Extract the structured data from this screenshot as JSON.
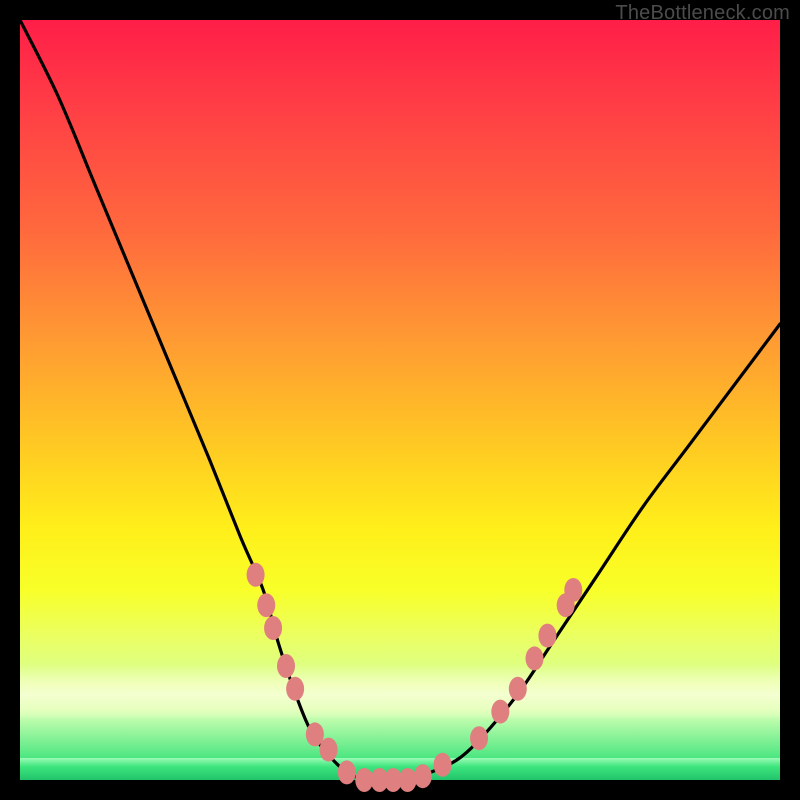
{
  "watermark": {
    "text": "TheBottleneck.com"
  },
  "colors": {
    "curve_stroke": "#000000",
    "marker_fill": "#e07f7f",
    "marker_stroke": "#e07f7f"
  },
  "chart_data": {
    "type": "line",
    "title": "",
    "xlabel": "",
    "ylabel": "",
    "xlim": [
      0,
      100
    ],
    "ylim": [
      0,
      100
    ],
    "grid": false,
    "series": [
      {
        "name": "bottleneck-curve",
        "x": [
          0,
          5,
          10,
          15,
          20,
          25,
          29,
          32,
          34,
          36,
          38,
          40,
          43,
          46,
          50,
          54,
          58,
          62,
          66,
          70,
          76,
          82,
          88,
          94,
          100
        ],
        "y": [
          100,
          90,
          78,
          66,
          54,
          42,
          32,
          25,
          18,
          12,
          7,
          4,
          1,
          0,
          0,
          1,
          3,
          7,
          12,
          18,
          27,
          36,
          44,
          52,
          60
        ]
      }
    ],
    "markers": [
      {
        "x": 31.0,
        "y": 27
      },
      {
        "x": 32.4,
        "y": 23
      },
      {
        "x": 33.3,
        "y": 20
      },
      {
        "x": 35.0,
        "y": 15
      },
      {
        "x": 36.2,
        "y": 12
      },
      {
        "x": 38.8,
        "y": 6
      },
      {
        "x": 40.6,
        "y": 4
      },
      {
        "x": 43.0,
        "y": 1
      },
      {
        "x": 45.3,
        "y": 0
      },
      {
        "x": 47.3,
        "y": 0
      },
      {
        "x": 49.1,
        "y": 0
      },
      {
        "x": 51.0,
        "y": 0
      },
      {
        "x": 53.0,
        "y": 0.5
      },
      {
        "x": 55.6,
        "y": 2
      },
      {
        "x": 60.4,
        "y": 5.5
      },
      {
        "x": 63.2,
        "y": 9
      },
      {
        "x": 65.5,
        "y": 12
      },
      {
        "x": 67.7,
        "y": 16
      },
      {
        "x": 69.4,
        "y": 19
      },
      {
        "x": 71.8,
        "y": 23
      },
      {
        "x": 72.8,
        "y": 25
      }
    ]
  }
}
